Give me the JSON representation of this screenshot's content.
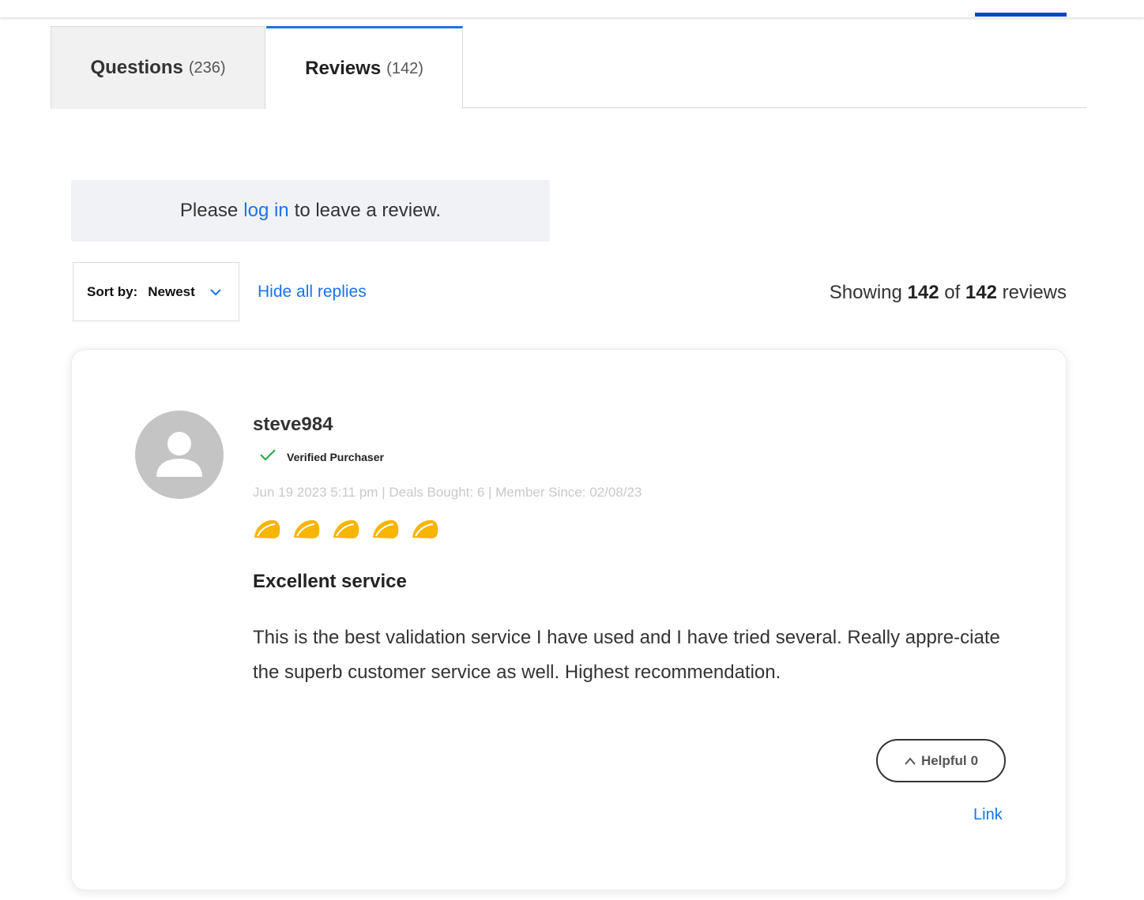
{
  "tabs": [
    {
      "label": "Questions",
      "count": "(236)",
      "active": false
    },
    {
      "label": "Reviews",
      "count": "(142)",
      "active": true
    }
  ],
  "login_notice": {
    "prefix": "Please",
    "link": "log in",
    "suffix": "to leave a review."
  },
  "sort": {
    "label": "Sort by:",
    "value": "Newest"
  },
  "hide_replies": "Hide all replies",
  "showing": {
    "prefix": "Showing",
    "shown": "142",
    "of": "of",
    "total": "142",
    "suffix": "reviews"
  },
  "review": {
    "username": "steve984",
    "verified_label": "Verified Purchaser",
    "meta": "Jun 19 2023 5:11 pm | Deals Bought: 6 | Member Since: 02/08/23",
    "rating": 5,
    "rating_icon": "taco-icon",
    "title": "Excellent service",
    "body": "This is the best validation service I have used and I have tried several. Really appre-ciate the superb customer service as well. Highest recommendation.",
    "helpful_label": "Helpful",
    "helpful_count": "0",
    "link_label": "Link"
  },
  "colors": {
    "accent_blue": "#1a73e8",
    "top_accent": "#0a47c2",
    "rating_gold": "#f7b500",
    "verified_green": "#2eaa4a",
    "avatar_gray": "#c4c4c4"
  }
}
